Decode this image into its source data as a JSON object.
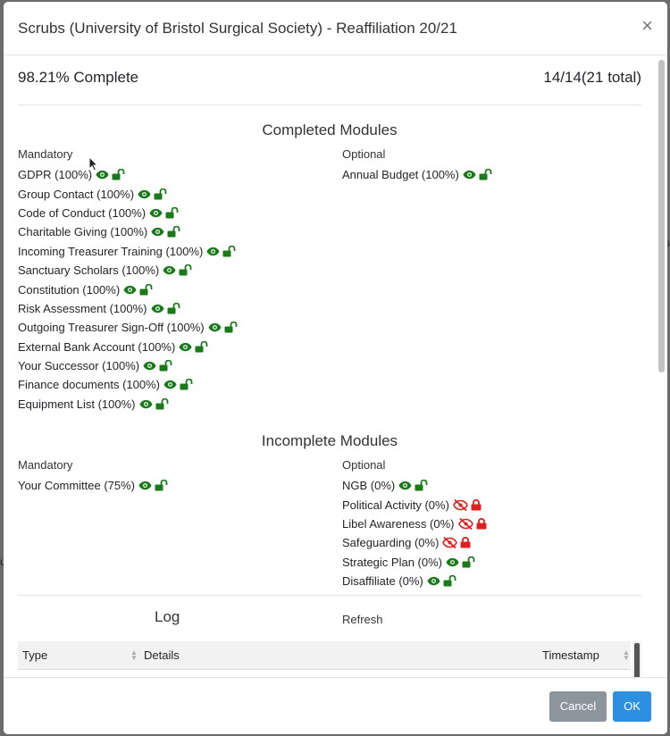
{
  "dialog": {
    "title": "Scrubs (University of Bristol Surgical Society) - Reaffiliation 20/21",
    "close_icon": "×"
  },
  "progress": {
    "percent_text": "98.21% Complete",
    "count_text": "14/14(21 total)"
  },
  "completed": {
    "title": "Completed Modules",
    "mandatory_label": "Mandatory",
    "optional_label": "Optional",
    "mandatory": [
      {
        "label": "GDPR (100%)",
        "visible": true,
        "locked": false
      },
      {
        "label": "Group Contact (100%)",
        "visible": true,
        "locked": false
      },
      {
        "label": "Code of Conduct (100%)",
        "visible": true,
        "locked": false
      },
      {
        "label": "Charitable Giving (100%)",
        "visible": true,
        "locked": false
      },
      {
        "label": "Incoming Treasurer Training (100%)",
        "visible": true,
        "locked": false
      },
      {
        "label": "Sanctuary Scholars (100%)",
        "visible": true,
        "locked": false
      },
      {
        "label": "Constitution (100%)",
        "visible": true,
        "locked": false
      },
      {
        "label": "Risk Assessment (100%)",
        "visible": true,
        "locked": false
      },
      {
        "label": "Outgoing Treasurer Sign-Off (100%)",
        "visible": true,
        "locked": false
      },
      {
        "label": "External Bank Account (100%)",
        "visible": true,
        "locked": false
      },
      {
        "label": "Your Successor (100%)",
        "visible": true,
        "locked": false
      },
      {
        "label": "Finance documents (100%)",
        "visible": true,
        "locked": false
      },
      {
        "label": "Equipment List (100%)",
        "visible": true,
        "locked": false
      }
    ],
    "optional": [
      {
        "label": "Annual Budget (100%)",
        "visible": true,
        "locked": false
      }
    ]
  },
  "incomplete": {
    "title": "Incomplete Modules",
    "mandatory_label": "Mandatory",
    "optional_label": "Optional",
    "mandatory": [
      {
        "label": "Your Committee (75%)",
        "visible": true,
        "locked": false
      }
    ],
    "optional": [
      {
        "label": "NGB (0%)",
        "visible": true,
        "locked": false
      },
      {
        "label": "Political Activity (0%)",
        "visible": false,
        "locked": true
      },
      {
        "label": "Libel Awareness (0%)",
        "visible": false,
        "locked": true
      },
      {
        "label": "Safeguarding (0%)",
        "visible": false,
        "locked": true
      },
      {
        "label": "Strategic Plan (0%)",
        "visible": true,
        "locked": false
      },
      {
        "label": "Disaffiliate (0%)",
        "visible": true,
        "locked": false
      }
    ]
  },
  "log": {
    "title": "Log",
    "refresh_label": "Refresh",
    "columns": [
      "Type",
      "Details",
      "Timestamp"
    ]
  },
  "footer": {
    "cancel_label": "Cancel",
    "ok_label": "OK"
  },
  "colors": {
    "green": "#1a7a1a",
    "red": "#e02020",
    "ok_button": "#2d8fe0",
    "cancel_button": "#8c949c"
  },
  "icons": {
    "visible": "eye-icon",
    "hidden": "eye-slash-icon",
    "unlocked": "unlock-icon",
    "locked": "lock-icon"
  }
}
